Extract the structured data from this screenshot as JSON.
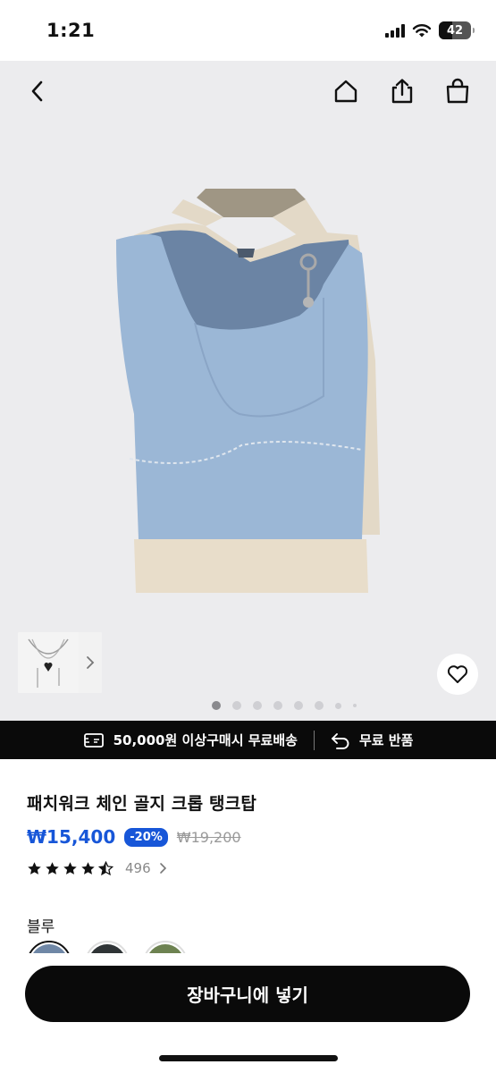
{
  "status_bar": {
    "time": "1:21",
    "battery": "42",
    "icons": [
      "signal-icon",
      "wifi-icon",
      "battery-icon"
    ]
  },
  "nav": {
    "icons": [
      "back-icon",
      "home-icon",
      "share-icon",
      "shopping-bag-icon"
    ]
  },
  "gallery": {
    "page_count": 8,
    "current_page": 1,
    "thumbnail_icon": "necklace-thumbnail",
    "wishlist_icon": "heart-icon"
  },
  "promo": {
    "shipping_text": "50,000원 이상구매시 무료배송",
    "return_text": "무료 반품"
  },
  "product": {
    "title": "패치워크 체인 골지 크롭 탱크탑",
    "price": "₩15,400",
    "discount": "-20%",
    "original_price": "₩19,200",
    "rating": 4.5,
    "review_count": "496",
    "color_label": "블루",
    "swatches": [
      {
        "color": "#6f87a6",
        "selected": true
      },
      {
        "color": "#2f3436",
        "selected": false
      },
      {
        "color": "#6d8251",
        "selected": false
      }
    ]
  },
  "cta": {
    "add_to_cart": "장바구니에 넣기"
  },
  "colors": {
    "accent": "#1756d8",
    "dark": "#0a0a0a",
    "hero_bg": "#ececee"
  }
}
